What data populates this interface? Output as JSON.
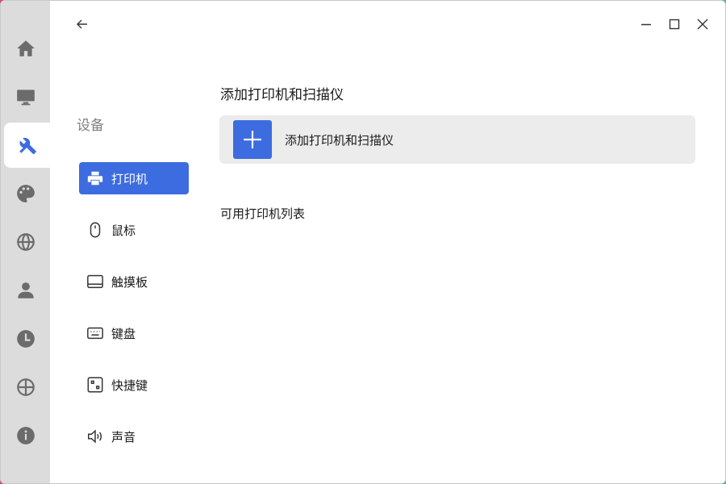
{
  "rail": {
    "items": [
      {
        "icon": "home-icon"
      },
      {
        "icon": "monitor-icon"
      },
      {
        "icon": "tools-icon",
        "active": true
      },
      {
        "icon": "palette-icon"
      },
      {
        "icon": "globe-icon"
      },
      {
        "icon": "user-icon"
      },
      {
        "icon": "clock-icon"
      },
      {
        "icon": "crosshair-icon"
      },
      {
        "icon": "info-icon"
      }
    ]
  },
  "sidebar": {
    "title": "设备",
    "items": [
      {
        "label": "打印机",
        "icon": "printer-icon",
        "active": true
      },
      {
        "label": "鼠标",
        "icon": "mouse-icon"
      },
      {
        "label": "触摸板",
        "icon": "touchpad-icon"
      },
      {
        "label": "键盘",
        "icon": "keyboard-icon"
      },
      {
        "label": "快捷键",
        "icon": "shortcut-icon"
      },
      {
        "label": "声音",
        "icon": "speaker-icon"
      }
    ]
  },
  "main": {
    "section_title": "添加打印机和扫描仪",
    "add_label": "添加打印机和扫描仪",
    "list_title": "可用打印机列表"
  },
  "colors": {
    "accent": "#3d6ce0",
    "rail_bg": "#dcdcdc",
    "card_bg": "#ececec"
  }
}
